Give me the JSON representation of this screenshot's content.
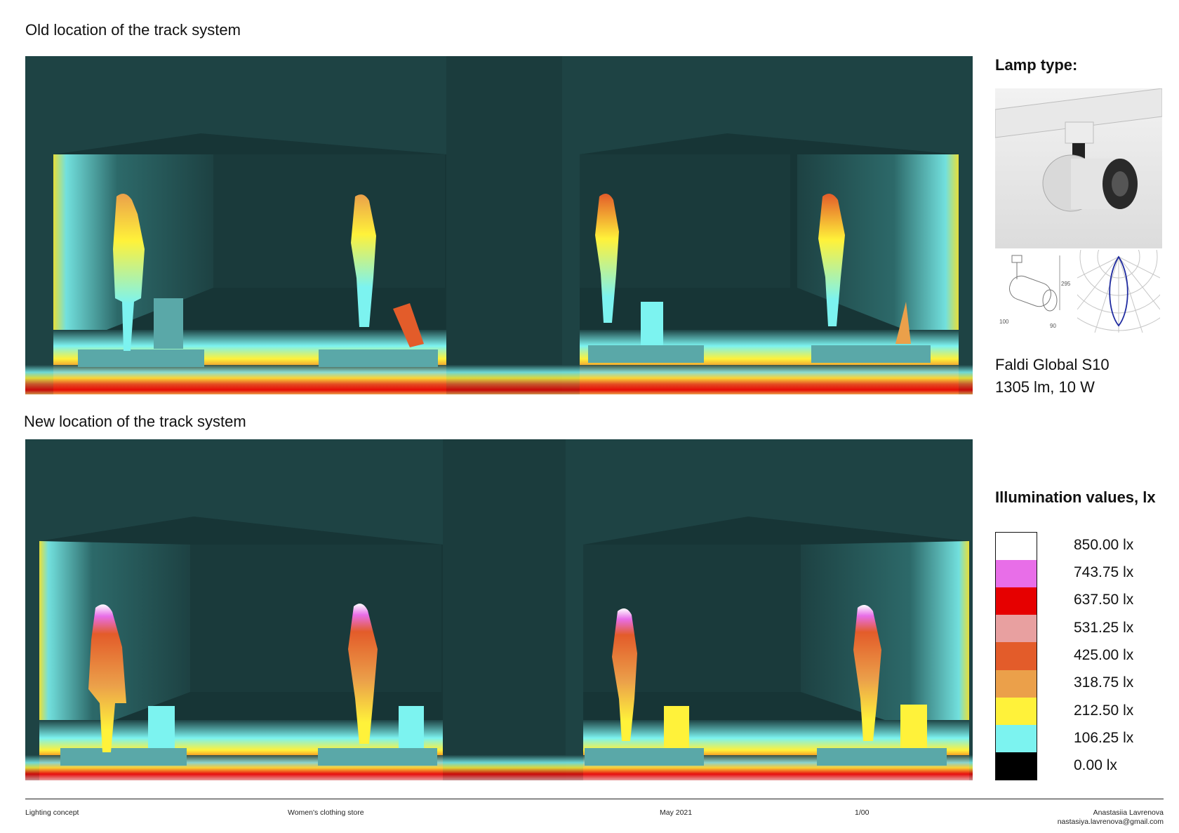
{
  "sections": {
    "old_title": "Old location of the track system",
    "new_title": "New location of the track system"
  },
  "lamp": {
    "heading": "Lamp type:",
    "model": "Faldi Global S10",
    "specs": "1305 lm, 10 W",
    "drawing_dims": [
      "295",
      "100",
      "90"
    ]
  },
  "legend": {
    "heading": "Illumination values, lx",
    "items": [
      {
        "label": "850.00 lx",
        "color": "#ffffff"
      },
      {
        "label": "743.75 lx",
        "color": "#e86ee8"
      },
      {
        "label": "637.50 lx",
        "color": "#e60000"
      },
      {
        "label": "531.25 lx",
        "color": "#e8a0a0"
      },
      {
        "label": "425.00 lx",
        "color": "#e35c2a"
      },
      {
        "label": "318.75 lx",
        "color": "#eba04a"
      },
      {
        "label": "212.50 lx",
        "color": "#fff23a"
      },
      {
        "label": "106.25 lx",
        "color": "#7cf3f0"
      },
      {
        "label": "0.00 lx",
        "color": "#000000"
      }
    ]
  },
  "footer": {
    "concept": "Lighting concept",
    "store": "Women's clothing store",
    "date": "May 2021",
    "sheet": "1/00",
    "author": "Anastasiia Lavrenova",
    "email": "nastasiya.lavrenova@gmail.com"
  },
  "colors": {
    "wall": "#1e4344",
    "wall_dark": "#173536",
    "accent_cyan": "#7cf3f0"
  }
}
